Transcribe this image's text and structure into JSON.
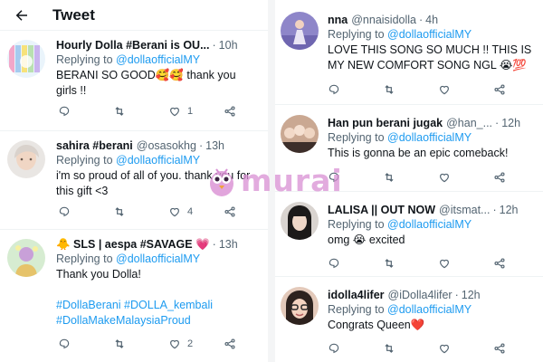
{
  "header": {
    "title": "Tweet"
  },
  "left_tweets": [
    {
      "name": "Hourly Dolla #Berani is OU...",
      "handle": "",
      "time": "10h",
      "replying_prefix": "Replying to ",
      "replying_to": "@dollaofficialMY",
      "text_lines": [
        "BERANI SO GOOD🥰🥰 thank you",
        "girls !!"
      ],
      "likes": "1"
    },
    {
      "name": "sahira #berani",
      "handle": "@osasokhg",
      "time": "13h",
      "replying_prefix": "Replying to ",
      "replying_to": "@dollaofficialMY",
      "text_lines": [
        "i'm so proud of all of you. thank you for",
        "this gift <3"
      ],
      "likes": "4"
    },
    {
      "name": "🐥 SLS | aespa #SAVAGE 💗",
      "handle": "",
      "time": "13h",
      "replying_prefix": "Replying to ",
      "replying_to": "@dollaofficialMY",
      "text_lines": [
        "Thank you Dolla!"
      ],
      "hashtag_lines": [
        "#DollaBerani #DOLLA_kembali",
        "#DollaMakeMalaysiaProud"
      ],
      "likes": "2"
    }
  ],
  "right_tweets": [
    {
      "name": "nna",
      "handle": "@nnaisidolla",
      "time": "4h",
      "replying_prefix": "Replying to ",
      "replying_to": "@dollaofficialMY",
      "text_lines": [
        "LOVE THIS SONG SO MUCH !! THIS IS",
        "MY NEW COMFORT SONG NGL 😭💯"
      ]
    },
    {
      "name": "Han pun berani jugak",
      "handle": "@han_...",
      "time": "12h",
      "replying_prefix": "Replying to ",
      "replying_to": "@dollaofficialMY",
      "text_lines": [
        "This is gonna be an epic comeback!"
      ]
    },
    {
      "name": "LALISA || OUT NOW",
      "handle": "@itsmat...",
      "time": "12h",
      "replying_prefix": "Replying to ",
      "replying_to": "@dollaofficialMY",
      "text_lines": [
        "omg 😭 excited"
      ]
    },
    {
      "name": "idolla4lifer",
      "handle": "@iDolla4lifer",
      "time": "12h",
      "replying_prefix": "Replying to ",
      "replying_to": "@dollaofficialMY",
      "text_lines": [
        "Congrats Queen❤️"
      ]
    }
  ],
  "watermark": {
    "text": "murai"
  },
  "icons": {
    "back": "arrow-left-icon",
    "reply": "reply-icon",
    "retweet": "retweet-icon",
    "like": "heart-icon",
    "share": "share-icon"
  },
  "colors": {
    "link": "#1d9bf0",
    "muted": "#536471",
    "text": "#0f1419",
    "watermark": "#d98fd3"
  }
}
